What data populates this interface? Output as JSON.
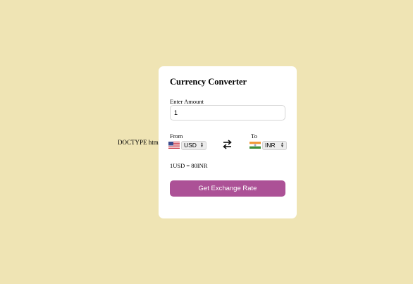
{
  "stray_text": "DOCTYPE html>",
  "converter": {
    "title": "Currency Converter",
    "amount_label": "Enter Amount",
    "amount_value": "1",
    "from_label": "From",
    "to_label": "To",
    "from_currency": "USD",
    "to_currency": "INR",
    "from_flag_icon": "us-flag-icon",
    "to_flag_icon": "india-flag-icon",
    "swap_icon": "swap-arrows-icon",
    "rate_text": "1USD = 80INR",
    "button_label": "Get Exchange Rate"
  },
  "colors": {
    "background": "#efe4b4",
    "card": "#ffffff",
    "button": "#ac5196",
    "button_text": "#ffffff"
  }
}
